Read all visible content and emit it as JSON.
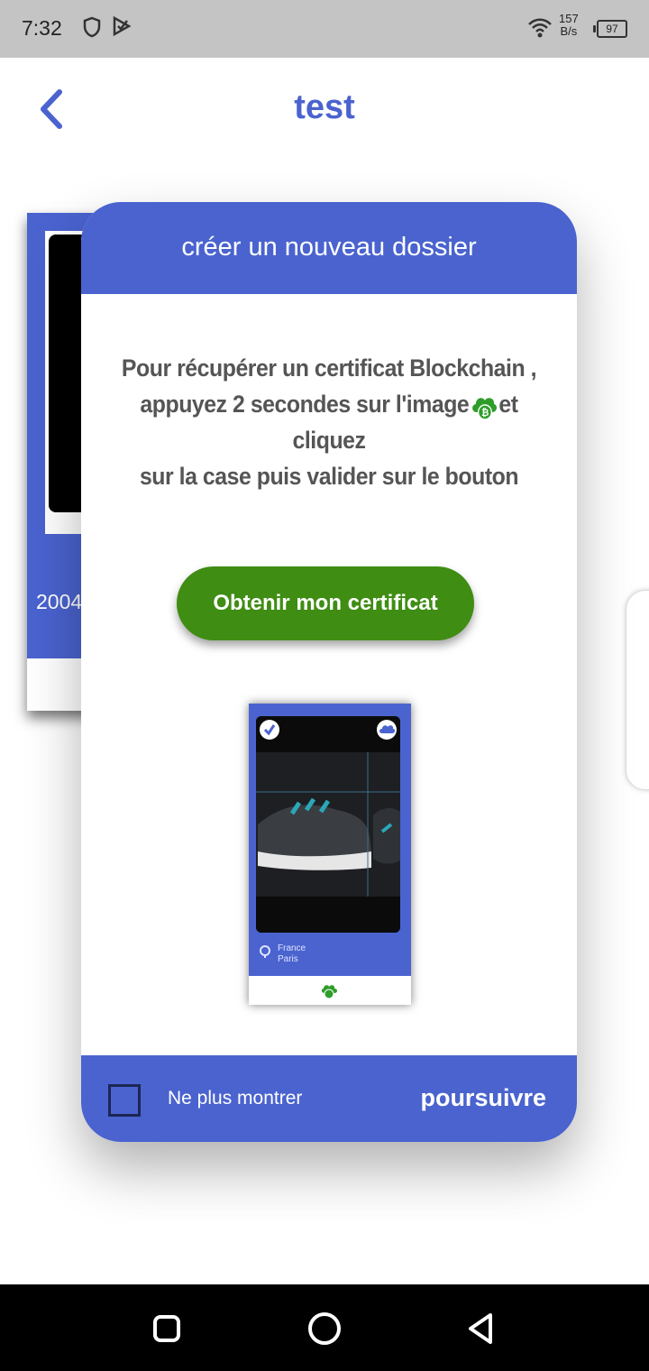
{
  "status_bar": {
    "time": "7:32",
    "net_speed_value": "157",
    "net_speed_unit": "B/s",
    "battery": "97",
    "icons": [
      "shield-icon",
      "play-protect-icon",
      "wifi-icon",
      "battery-icon"
    ]
  },
  "header": {
    "title": "test",
    "back_icon": "chevron-left-icon"
  },
  "background_card": {
    "year_text": "2004"
  },
  "dialog": {
    "title": "créer un nouveau dossier",
    "instructions_line1": "Pour récupérer un certificat Blockchain ,",
    "instructions_line2a": "appuyez 2 secondes sur l'image",
    "instructions_line2b": "et cliquez",
    "instructions_line3": "sur la case puis valider sur le bouton",
    "certificate_button": "Obtenir mon certificat",
    "preview": {
      "location_line1": "France",
      "location_line2": "Paris"
    },
    "checkbox_label": "Ne plus montrer",
    "checkbox_checked": false,
    "continue_label": "poursuivre"
  },
  "colors": {
    "accent": "#4a63cf",
    "button_green": "#3f8d13",
    "cloud_green": "#2e9e2a"
  },
  "nav_bar": {
    "items": [
      "recents-icon",
      "home-icon",
      "back-icon"
    ]
  }
}
